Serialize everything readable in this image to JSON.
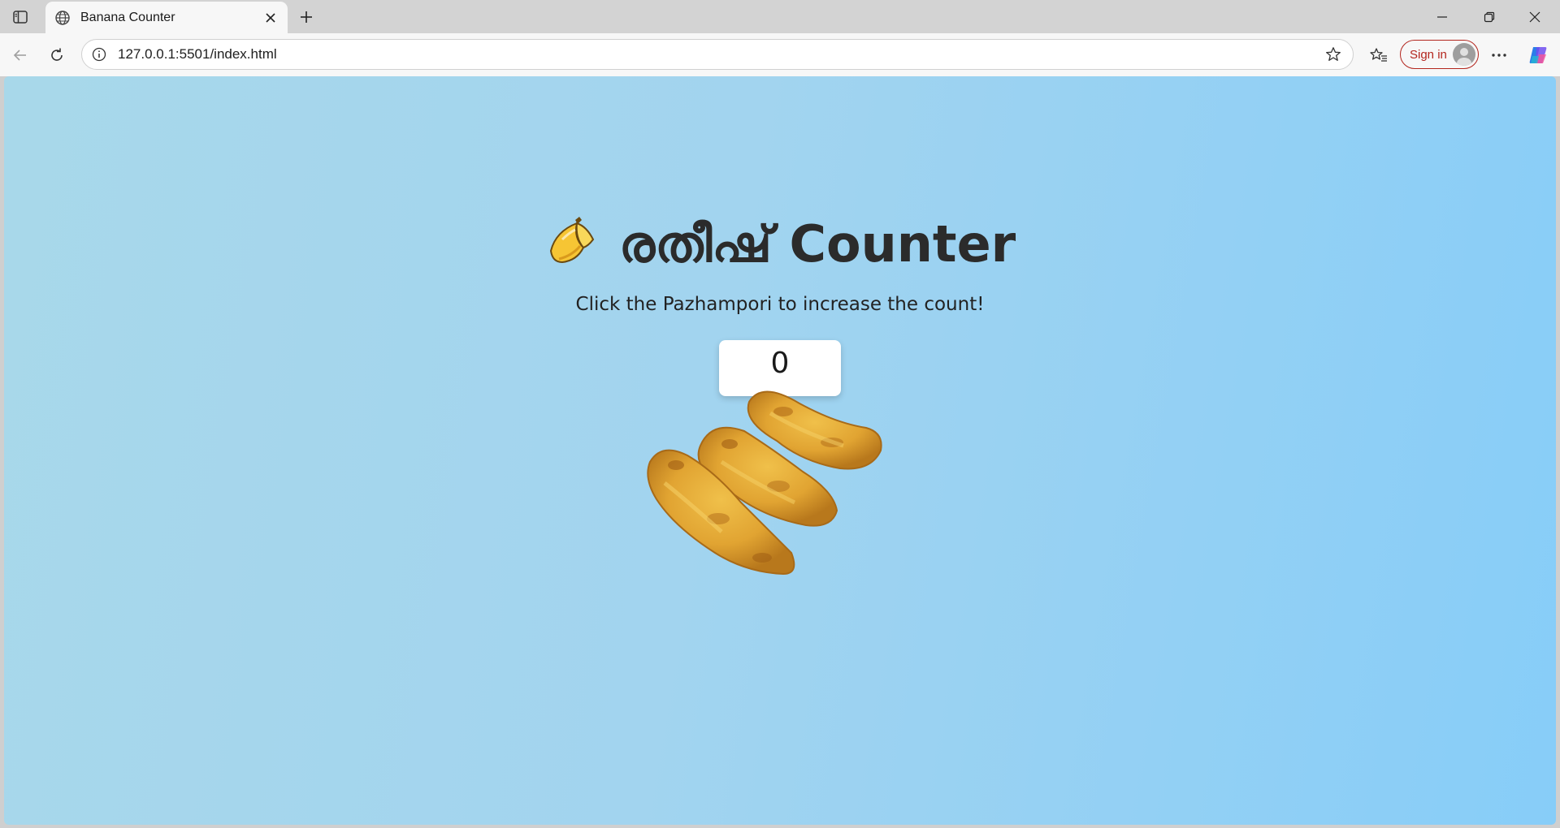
{
  "browser": {
    "tab_title": "Banana Counter",
    "url": "127.0.0.1:5501/index.html",
    "signin_label": "Sign in",
    "accent_color": "#b3261e"
  },
  "icons": {
    "sidebar": "sidebar-toggle-icon",
    "favicon": "globe-icon",
    "tab_close": "close-icon",
    "new_tab": "plus-icon",
    "back": "arrow-left-icon",
    "reload": "reload-icon",
    "site_info": "info-icon",
    "favorite": "star-icon",
    "favorites_list": "favorites-icon",
    "more": "more-icon",
    "copilot": "copilot-icon"
  },
  "page": {
    "emoji": "🍌",
    "title": "രതീഷ് Counter",
    "subtitle": "Click the Pazhampori to increase the count!",
    "count": "0",
    "background_gradient": [
      "#a8d8ea",
      "#87cdf8"
    ]
  }
}
